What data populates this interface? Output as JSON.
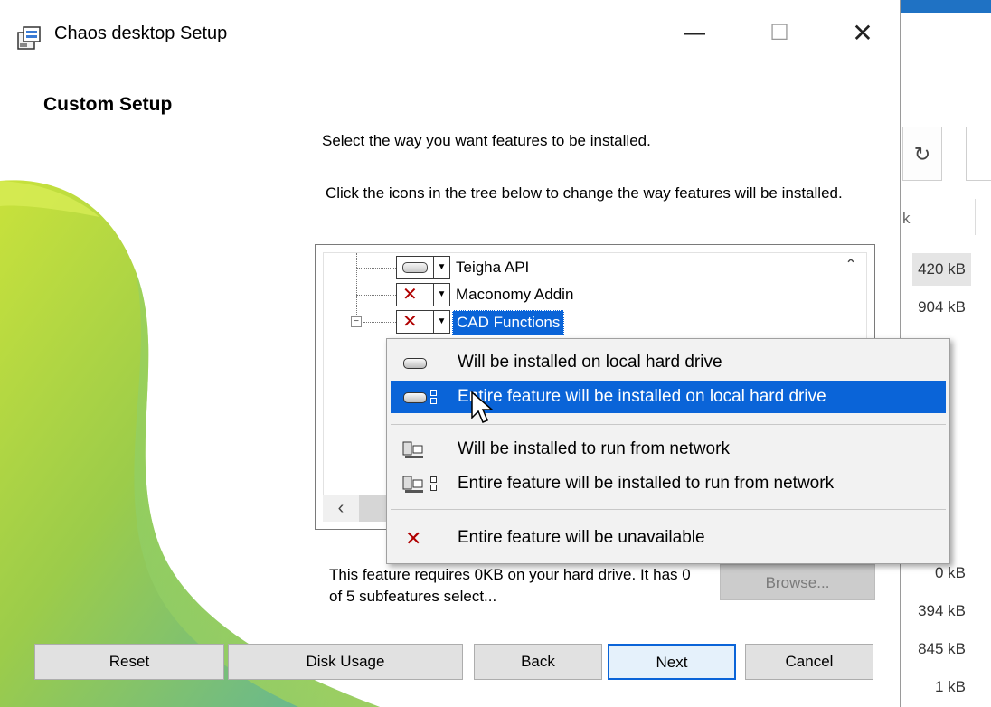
{
  "background_window": {
    "refresh_icon": "refresh-icon",
    "column_partial": "k",
    "sizes": [
      "420 kB",
      "904 kB",
      "0 kB",
      "394 kB",
      "845 kB",
      "1 kB"
    ]
  },
  "dialog": {
    "title": "Chaos desktop Setup",
    "heading": "Custom Setup",
    "instruction_1": "Select the way you want features to be installed.",
    "instruction_2": "Click the icons in the tree below to change the way features will be installed.",
    "tree": {
      "items": [
        {
          "label": "Teigha API",
          "state": "drive"
        },
        {
          "label": "Maconomy Addin",
          "state": "unavailable"
        },
        {
          "label": "CAD Functions",
          "state": "unavailable",
          "selected": true
        }
      ]
    },
    "description": "This feature requires 0KB on your hard drive. It has 0 of 5 subfeatures select...",
    "browse_label": "Browse...",
    "buttons": {
      "reset": "Reset",
      "disk_usage": "Disk Usage",
      "back": "Back",
      "next": "Next",
      "cancel": "Cancel"
    }
  },
  "menu": {
    "items": [
      {
        "label": "Will be installed on local hard drive",
        "icon": "hard-drive-icon"
      },
      {
        "label": "Entire feature will be installed on local hard drive",
        "icon": "hard-drive-entire-icon",
        "highlighted": true
      },
      {
        "label": "Will be installed to run from network",
        "icon": "network-icon"
      },
      {
        "label": "Entire feature will be installed to run from network",
        "icon": "network-entire-icon"
      },
      {
        "label": "Entire feature will be unavailable",
        "icon": "unavailable-x-icon"
      }
    ]
  },
  "colors": {
    "accent": "#0a64d8",
    "unavailable": "#b00000",
    "wave_green": "#a7d23a",
    "wave_teal": "#5fb39a"
  }
}
